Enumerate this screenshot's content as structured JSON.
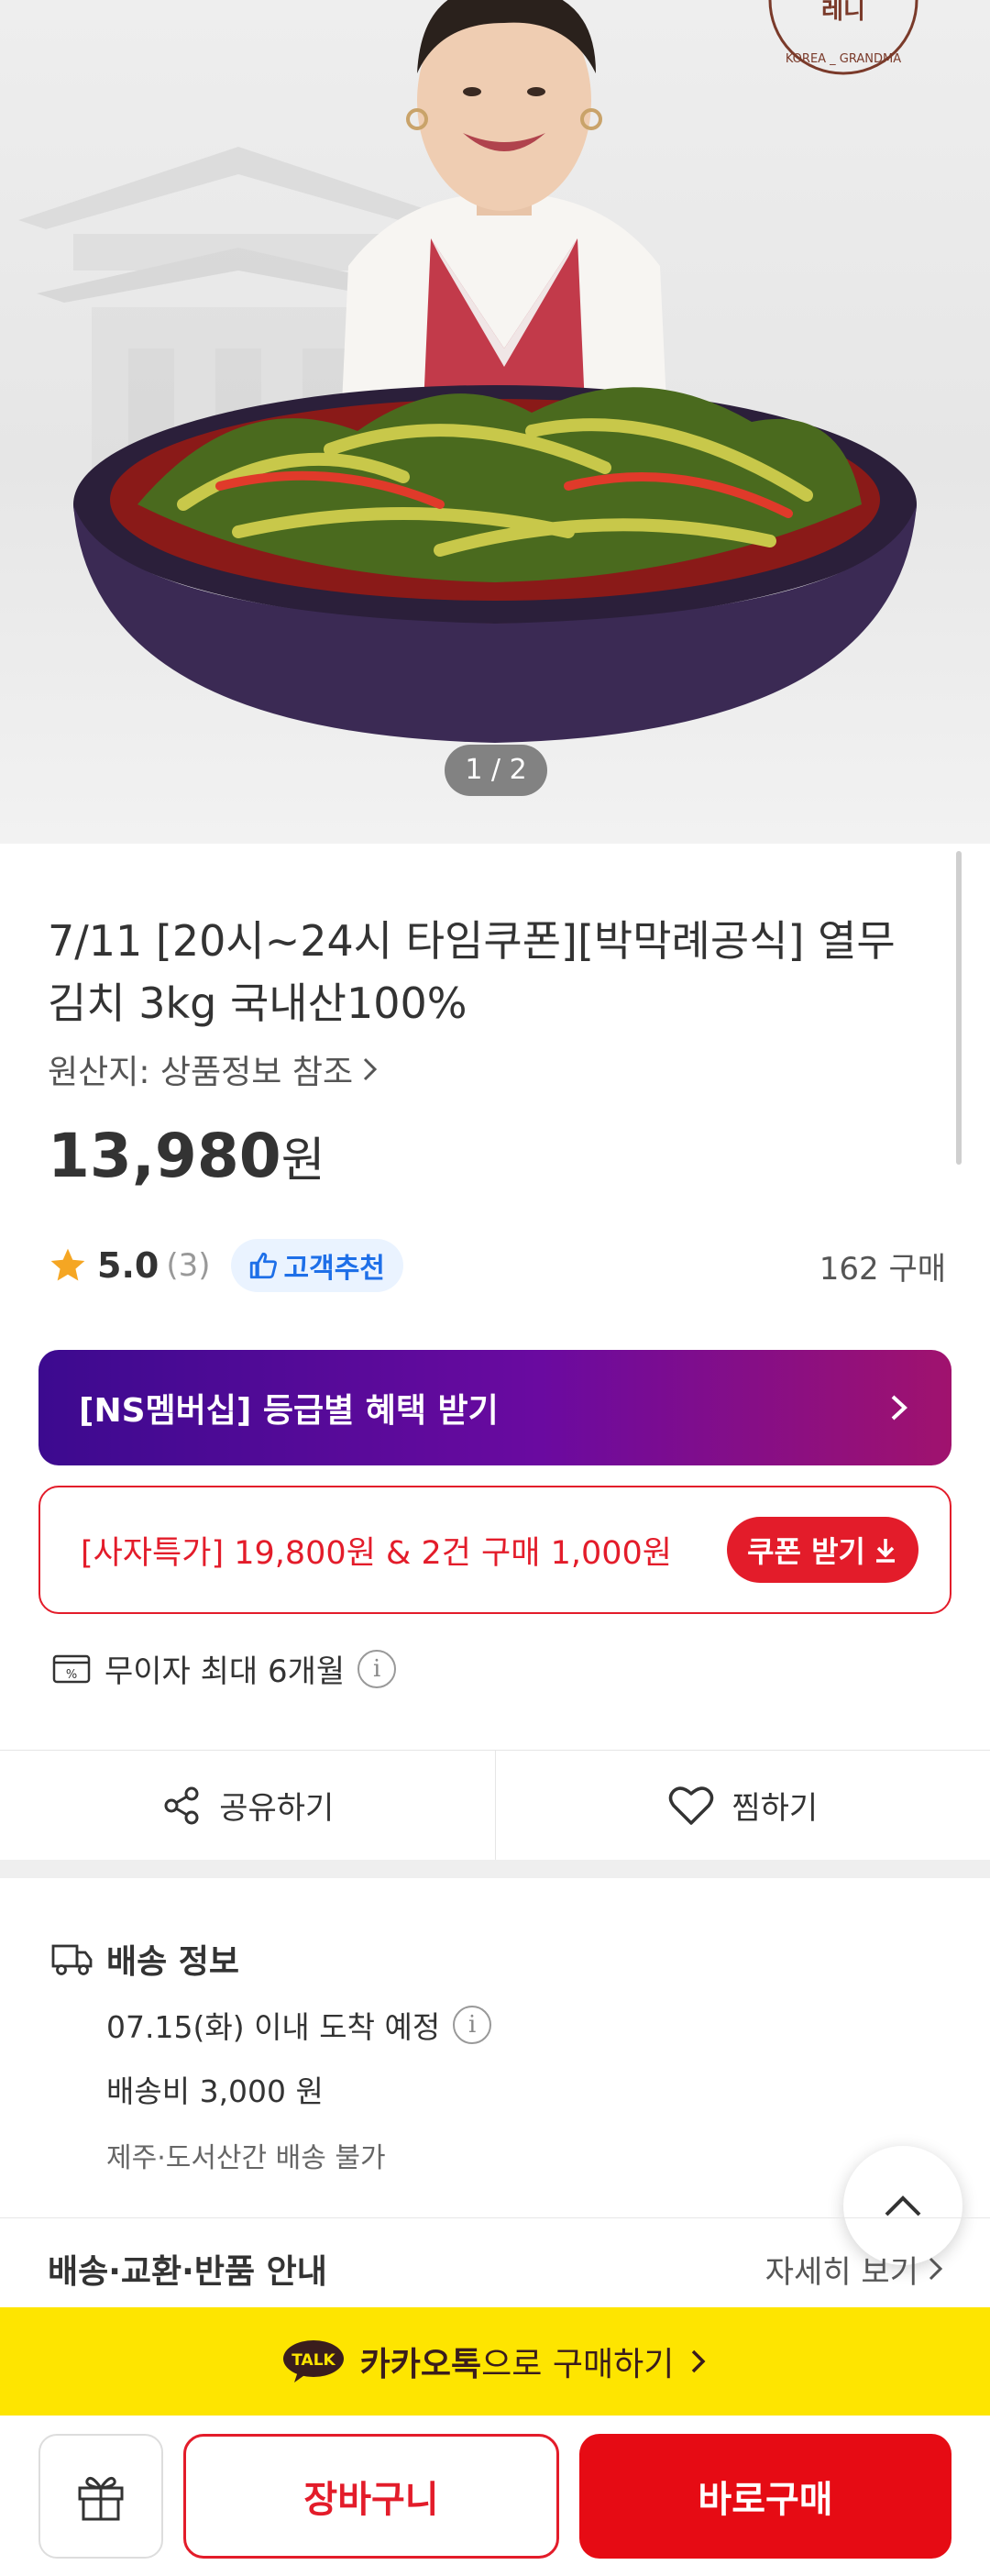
{
  "gallery": {
    "counter": "1 / 2",
    "current": 1,
    "total": 2
  },
  "product": {
    "title": "7/11 [20시~24시 타임쿠폰][박막례공식] 열무김치 3kg 국내산100%",
    "origin": "원산지: 상품정보 참조",
    "price": "13,980",
    "currency": "원",
    "rating": "5.0",
    "review_count": "(3)",
    "recommend_badge": "고객추천",
    "purchase_count": "162 구매"
  },
  "membership_banner": {
    "label": "[NS멤버십] 등급별 혜택 받기"
  },
  "coupon": {
    "text": "[사자특가] 19,800원 & 2건 구매 1,000원",
    "button": "쿠폰 받기"
  },
  "installment": {
    "text": "무이자 최대 6개월"
  },
  "actions": {
    "share": "공유하기",
    "wish": "찜하기"
  },
  "delivery": {
    "title": "배송 정보",
    "arrival": "07.15(화) 이내 도착 예정",
    "fee": "배송비 3,000 원",
    "note": "제주·도서산간 배송 불가"
  },
  "policy": {
    "label": "배송·교환·반품 안내",
    "more": "자세히 보기"
  },
  "kakao": {
    "badge": "TALK",
    "brand": "카카오톡",
    "rest": "으로 구매하기"
  },
  "bottom": {
    "cart": "장바구니",
    "buy": "바로구매"
  },
  "colors": {
    "accent_red": "#e31c2a",
    "kakao_yellow": "#fee500",
    "banner_purple": "#3c0a8f",
    "star": "#f5a623"
  }
}
